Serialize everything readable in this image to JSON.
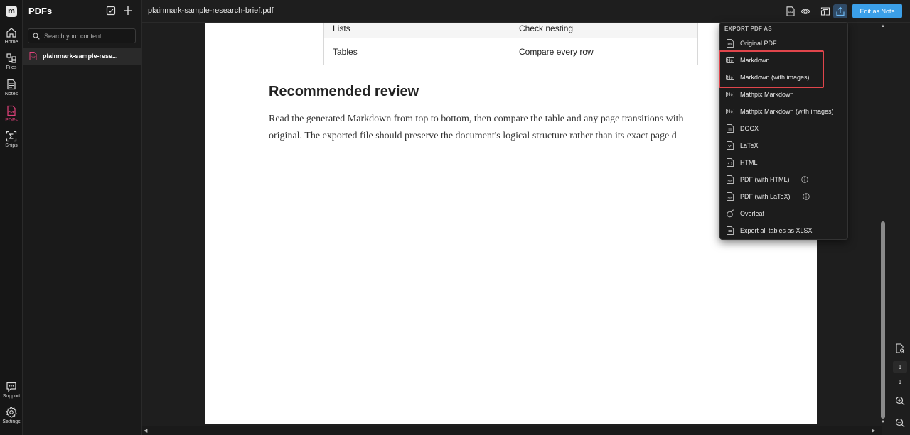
{
  "rail": {
    "logo": "m",
    "items": [
      {
        "label": "Home",
        "icon": "home-icon"
      },
      {
        "label": "Files",
        "icon": "files-icon"
      },
      {
        "label": "Notes",
        "icon": "notes-icon"
      },
      {
        "label": "PDFs",
        "icon": "pdf-icon",
        "active": true
      },
      {
        "label": "Snips",
        "icon": "sigma-icon"
      },
      {
        "label": "Support",
        "icon": "support-icon"
      },
      {
        "label": "Settings",
        "icon": "gear-icon"
      }
    ]
  },
  "sidebar": {
    "title": "PDFs",
    "search_placeholder": "Search your content",
    "files": [
      {
        "name": "plainmark-sample-rese..."
      }
    ]
  },
  "topbar": {
    "doc_title": "plainmark-sample-research-brief.pdf",
    "edit_button": "Edit as Note"
  },
  "document": {
    "table_rows": [
      [
        "Lists",
        "Check nesting"
      ],
      [
        "Tables",
        "Compare every row"
      ]
    ],
    "heading": "Recommended review",
    "paragraph_lines": [
      "Read the generated Markdown from top to bottom, then compare the table and any page transitions with",
      "original. The exported file should preserve the document's logical structure rather than its exact page d"
    ]
  },
  "pager": {
    "current": "1",
    "total": "1"
  },
  "export_menu": {
    "heading": "EXPORT PDF AS",
    "items": [
      {
        "label": "Original PDF",
        "icon": "pdf-file-icon"
      },
      {
        "label": "Markdown",
        "icon": "markdown-icon"
      },
      {
        "label": "Markdown (with images)",
        "icon": "markdown-icon"
      },
      {
        "label": "Mathpix Markdown",
        "icon": "markdown-icon"
      },
      {
        "label": "Mathpix Markdown (with images)",
        "icon": "markdown-icon"
      },
      {
        "label": "DOCX",
        "icon": "docx-file-icon"
      },
      {
        "label": "LaTeX",
        "icon": "latex-file-icon"
      },
      {
        "label": "HTML",
        "icon": "html-file-icon"
      },
      {
        "label": "PDF (with HTML)",
        "icon": "pdf-file-icon",
        "info": true
      },
      {
        "label": "PDF (with LaTeX)",
        "icon": "pdf-file-icon",
        "info": true
      },
      {
        "label": "Overleaf",
        "icon": "overleaf-icon"
      },
      {
        "label": "Export all tables as XLSX",
        "icon": "spreadsheet-icon"
      }
    ]
  },
  "colors": {
    "accent": "#3b9fe8",
    "active_nav": "#e0417b",
    "highlight": "#e0454b"
  }
}
